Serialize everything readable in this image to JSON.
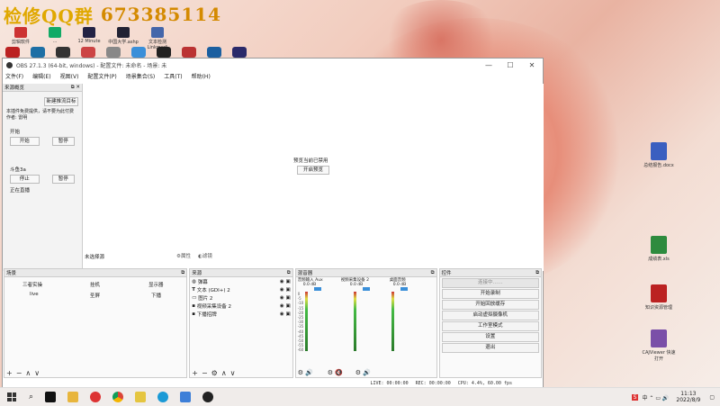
{
  "banner": {
    "text_a": "检修QQ群",
    "text_b": "673385114"
  },
  "desktop_top_icons": [
    {
      "label": "剪辑软件",
      "color": "#c33"
    },
    {
      "label": "...",
      "color": "#1a6"
    },
    {
      "label": "12 Minute",
      "color": "#224"
    },
    {
      "label": "中国大学.ashp",
      "color": "#223"
    },
    {
      "label": "文本检测 Linkmedi",
      "color": "#46a"
    }
  ],
  "desktop_right_icons": [
    {
      "label": "总结报告.docx",
      "color": "#3a5fc0"
    },
    {
      "label": "成绩表.xls",
      "color": "#2e8b3e"
    },
    {
      "label": "知识资源管理",
      "color": "#b22"
    },
    {
      "label": "CAJViewer 快速打开",
      "color": "#7a4fa8"
    }
  ],
  "window": {
    "title": "OBS 27.1.3 (64-bit, windows) - 配置文件: 未命名 - 场景: 未",
    "menu": [
      "文件(F)",
      "编辑(E)",
      "视图(V)",
      "配置文件(P)",
      "场景集合(S)",
      "工具(T)",
      "帮助(H)"
    ]
  },
  "sources_dock": {
    "title": "来源概览",
    "new_button": "新建推流目标",
    "info_line1": "本插件免费提供，请不要为此付费",
    "info_line2": "作者: 雷明",
    "section_a": "开始",
    "start_btn": "开始",
    "stop_btn_a": "暂停",
    "section_b": "斗鱼3a",
    "stop_btn": "停止",
    "pause_btn": "暂停",
    "live_text": "正在直播"
  },
  "preview": {
    "disabled_text": "预览当前已禁用",
    "enable_button": "开启预览",
    "no_source": "未选择源",
    "props_btn": "属性",
    "filters_btn": "滤镜"
  },
  "scenes": {
    "title": "场景",
    "items": [
      "三者实操",
      "挂机",
      "显示器",
      "live",
      "圣屏",
      "下播"
    ]
  },
  "sources": {
    "title": "来源",
    "items": [
      "弹幕",
      "文本 (GDI+) 2",
      "图片 2",
      "视频采集设备 2",
      "下播招牌"
    ]
  },
  "mixer": {
    "title": "混音器",
    "channels": [
      {
        "name": "音频输入 Aux",
        "db": "0.0 dB"
      },
      {
        "name": "视频采集设备 2",
        "db": "0.0 dB"
      },
      {
        "name": "桌面音频",
        "db": "0.0 dB"
      }
    ],
    "scale": [
      "0",
      "-5",
      "-10",
      "-15",
      "-20",
      "-25",
      "-30",
      "-35",
      "-40",
      "-45",
      "-50",
      "-55",
      "-60"
    ]
  },
  "controls": {
    "title": "控件",
    "buttons": [
      "连接中……",
      "开始录制",
      "开始回放缓存",
      "启动虚拟摄像机",
      "工作室模式",
      "设置",
      "退出"
    ]
  },
  "status": {
    "live": "LIVE: 00:00:00",
    "rec": "REC: 00:00:00",
    "cpu": "CPU: 4.4%, 60.00 fps"
  },
  "taskbar": {
    "time": "11:13",
    "date": "2022/8/9"
  }
}
